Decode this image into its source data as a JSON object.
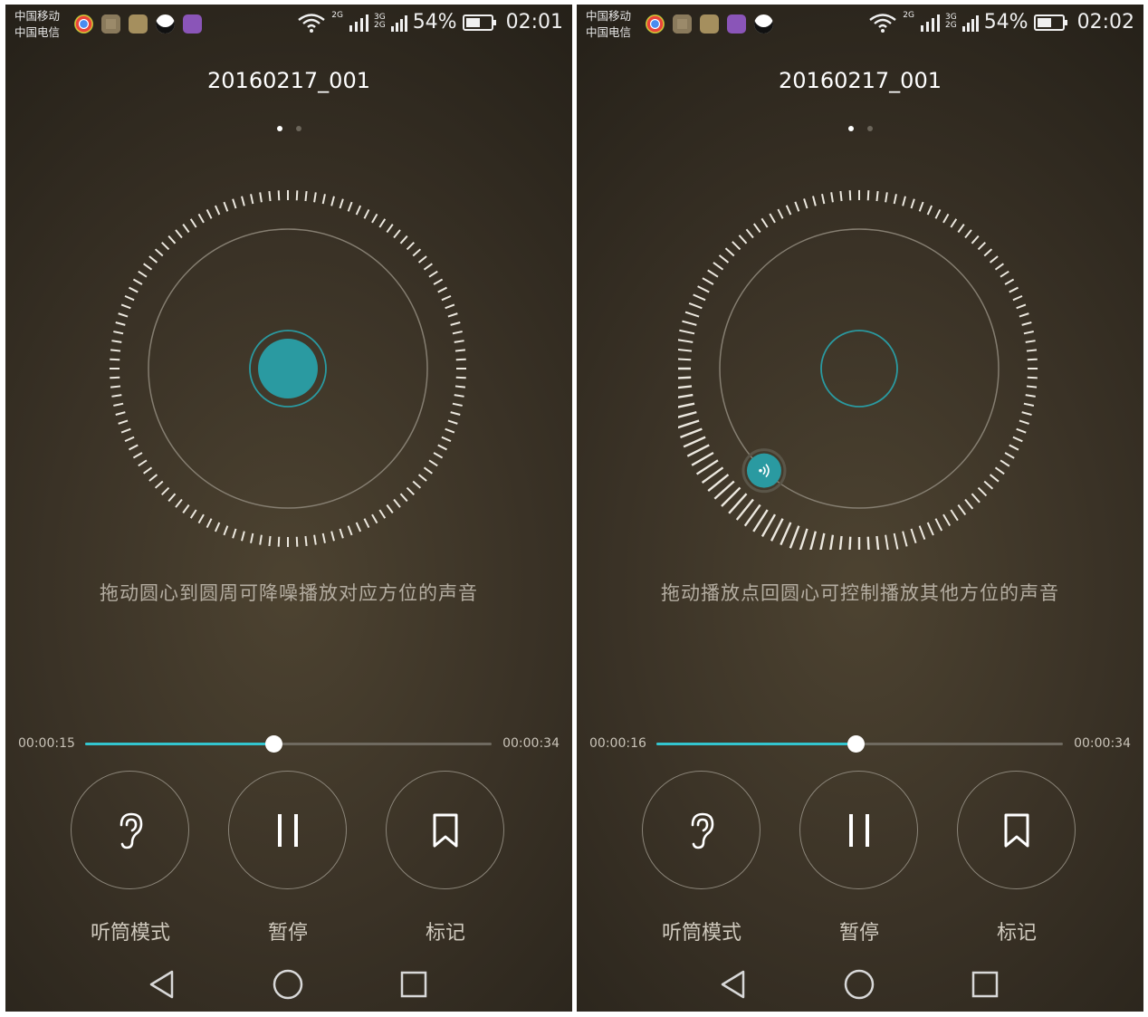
{
  "colors": {
    "accent": "#33c5cf",
    "ring": "#2a9aa1",
    "text_secondary": "#b4ada1"
  },
  "screens": [
    {
      "status": {
        "carrier1": "中国移动",
        "carrier2": "中国电信",
        "net1": "2G",
        "net2a": "3G",
        "net2b": "2G",
        "battery": "54%",
        "time": "02:01",
        "notification_icons": [
          "chrome-icon",
          "camera-app-icon",
          "health-app-icon",
          "qq-icon",
          "gallery-icon"
        ]
      },
      "title": "20160217_001",
      "page_indicator": {
        "count": 2,
        "active": 0
      },
      "dial": {
        "state": "center",
        "playback_position_deg": null
      },
      "hint": "拖动圆心到圆周可降噪播放对应方位的声音",
      "playback": {
        "current": "00:00:15",
        "total": "00:00:34",
        "progress": 0.464
      },
      "controls": {
        "earpiece": "听筒模式",
        "pause": "暂停",
        "mark": "标记"
      },
      "nav": [
        "back-icon",
        "home-icon",
        "recents-icon"
      ]
    },
    {
      "status": {
        "carrier1": "中国移动",
        "carrier2": "中国电信",
        "net1": "2G",
        "net2a": "3G",
        "net2b": "2G",
        "battery": "54%",
        "time": "02:02",
        "notification_icons": [
          "chrome-icon",
          "camera-app-icon",
          "health-app-icon",
          "gallery-icon",
          "qq-icon"
        ]
      },
      "title": "20160217_001",
      "page_indicator": {
        "count": 2,
        "active": 0
      },
      "dial": {
        "state": "on-circle",
        "playback_position_deg": 133
      },
      "hint": "拖动播放点回圆心可控制播放其他方位的声音",
      "playback": {
        "current": "00:00:16",
        "total": "00:00:34",
        "progress": 0.49
      },
      "controls": {
        "earpiece": "听筒模式",
        "pause": "暂停",
        "mark": "标记"
      },
      "nav": [
        "back-icon",
        "home-icon",
        "recents-icon"
      ]
    }
  ]
}
